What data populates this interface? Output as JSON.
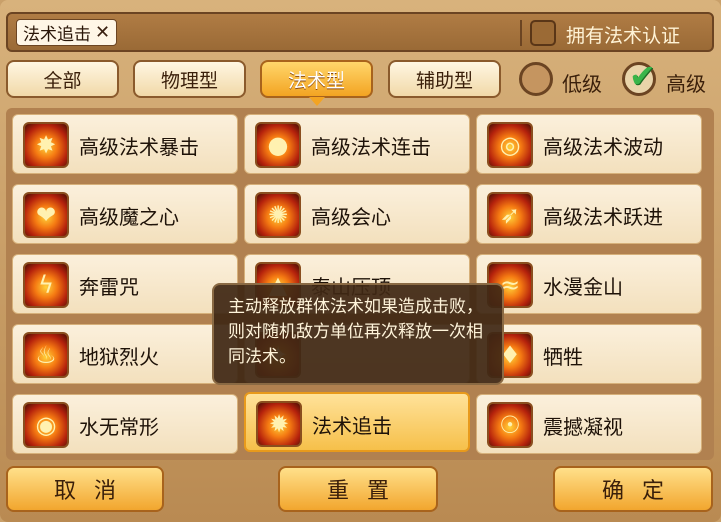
{
  "search": {
    "chip_text": "法术追击",
    "chip_remove": "✕",
    "cert_label": "拥有法术认证"
  },
  "tabs": [
    {
      "label": "全部"
    },
    {
      "label": "物理型"
    },
    {
      "label": "法术型"
    },
    {
      "label": "辅助型"
    }
  ],
  "levels": [
    {
      "label": "低级",
      "checked": false
    },
    {
      "label": "高级",
      "checked": true
    }
  ],
  "skills": [
    {
      "label": "高级法术暴击",
      "icon": "fire-burst-icon"
    },
    {
      "label": "高级法术连击",
      "icon": "fire-orb-icon"
    },
    {
      "label": "高级法术波动",
      "icon": "fire-wave-icon"
    },
    {
      "label": "高级魔之心",
      "icon": "fire-heart-icon"
    },
    {
      "label": "高级会心",
      "icon": "fire-mind-icon"
    },
    {
      "label": "高级法术跃进",
      "icon": "fire-leap-icon"
    },
    {
      "label": "奔雷咒",
      "icon": "thunder-icon"
    },
    {
      "label": "泰山压顶",
      "icon": "mountain-icon"
    },
    {
      "label": "水漫金山",
      "icon": "flood-icon"
    },
    {
      "label": "地狱烈火",
      "icon": "hellfire-icon"
    },
    {
      "label": "",
      "icon": "hidden-icon"
    },
    {
      "label": "牺牲",
      "icon": "sacrifice-icon"
    },
    {
      "label": "水无常形",
      "icon": "water-shape-icon"
    },
    {
      "label": "法术追击",
      "icon": "spell-chase-icon"
    },
    {
      "label": "震撼凝视",
      "icon": "gaze-icon"
    }
  ],
  "tooltip": {
    "text": "主动释放群体法术如果造成击败，则对随机敌方单位再次释放一次相同法术。"
  },
  "buttons": {
    "cancel": "取消",
    "reset": "重置",
    "confirm": "确定"
  },
  "colors": {
    "accent": "#f3a422",
    "panel": "#b18150",
    "check": "#39b54a"
  }
}
